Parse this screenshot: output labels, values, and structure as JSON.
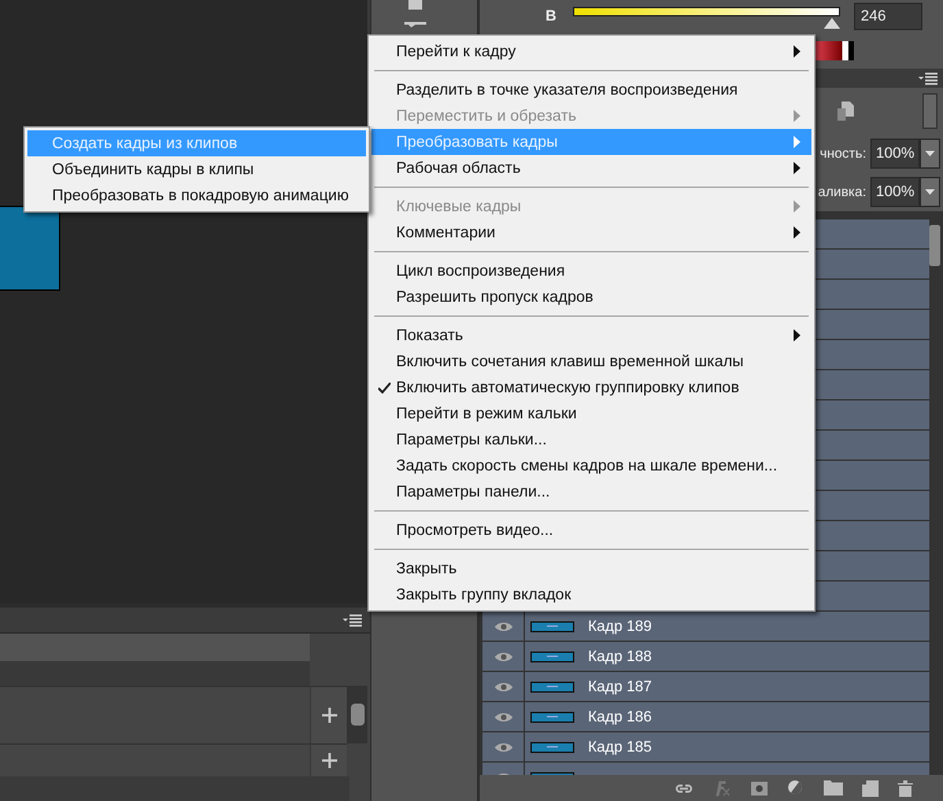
{
  "color_panel": {
    "channel_label": "В",
    "level": 0.97,
    "value": "246"
  },
  "layers_panel": {
    "opacity_label": "чность:",
    "opacity": "100%",
    "fill_label": "аливка:",
    "fill": "100%",
    "layers": [
      {
        "name": "Кадр 189"
      },
      {
        "name": "Кадр 188"
      },
      {
        "name": "Кадр 187"
      },
      {
        "name": "Кадр 186"
      },
      {
        "name": "Кадр 185"
      }
    ]
  },
  "context_menu": {
    "items": [
      {
        "kind": "item",
        "label": "Перейти к кадру",
        "submenu": true,
        "disabled": false,
        "selected": false,
        "checked": false
      },
      {
        "kind": "separator"
      },
      {
        "kind": "item",
        "label": "Разделить в точке указателя воспроизведения",
        "submenu": false,
        "disabled": false,
        "selected": false,
        "checked": false
      },
      {
        "kind": "item",
        "label": "Переместить и обрезать",
        "submenu": true,
        "disabled": true,
        "selected": false,
        "checked": false
      },
      {
        "kind": "item",
        "label": "Преобразовать кадры",
        "submenu": true,
        "disabled": false,
        "selected": true,
        "checked": false
      },
      {
        "kind": "item",
        "label": "Рабочая область",
        "submenu": true,
        "disabled": false,
        "selected": false,
        "checked": false
      },
      {
        "kind": "separator"
      },
      {
        "kind": "item",
        "label": "Ключевые кадры",
        "submenu": true,
        "disabled": true,
        "selected": false,
        "checked": false
      },
      {
        "kind": "item",
        "label": "Комментарии",
        "submenu": true,
        "disabled": false,
        "selected": false,
        "checked": false
      },
      {
        "kind": "separator"
      },
      {
        "kind": "item",
        "label": "Цикл воспроизведения",
        "submenu": false,
        "disabled": false,
        "selected": false,
        "checked": false
      },
      {
        "kind": "item",
        "label": "Разрешить пропуск кадров",
        "submenu": false,
        "disabled": false,
        "selected": false,
        "checked": false
      },
      {
        "kind": "separator"
      },
      {
        "kind": "item",
        "label": "Показать",
        "submenu": true,
        "disabled": false,
        "selected": false,
        "checked": false
      },
      {
        "kind": "item",
        "label": "Включить сочетания клавиш временной шкалы",
        "submenu": false,
        "disabled": false,
        "selected": false,
        "checked": false
      },
      {
        "kind": "item",
        "label": "Включить автоматическую группировку клипов",
        "submenu": false,
        "disabled": false,
        "selected": false,
        "checked": true
      },
      {
        "kind": "item",
        "label": "Перейти в режим кальки",
        "submenu": false,
        "disabled": false,
        "selected": false,
        "checked": false
      },
      {
        "kind": "item",
        "label": "Параметры кальки...",
        "submenu": false,
        "disabled": false,
        "selected": false,
        "checked": false
      },
      {
        "kind": "item",
        "label": "Задать скорость смены кадров на шкале времени...",
        "submenu": false,
        "disabled": false,
        "selected": false,
        "checked": false
      },
      {
        "kind": "item",
        "label": "Параметры панели...",
        "submenu": false,
        "disabled": false,
        "selected": false,
        "checked": false
      },
      {
        "kind": "separator"
      },
      {
        "kind": "item",
        "label": "Просмотреть видео...",
        "submenu": false,
        "disabled": false,
        "selected": false,
        "checked": false
      },
      {
        "kind": "separator"
      },
      {
        "kind": "item",
        "label": "Закрыть",
        "submenu": false,
        "disabled": false,
        "selected": false,
        "checked": false
      },
      {
        "kind": "item",
        "label": "Закрыть группу вкладок",
        "submenu": false,
        "disabled": false,
        "selected": false,
        "checked": false
      }
    ]
  },
  "submenu": {
    "items": [
      {
        "label": "Создать кадры из клипов",
        "selected": true
      },
      {
        "label": "Объединить кадры в клипы",
        "selected": false
      },
      {
        "label": "Преобразовать в покадровую анимацию",
        "selected": false
      }
    ]
  }
}
